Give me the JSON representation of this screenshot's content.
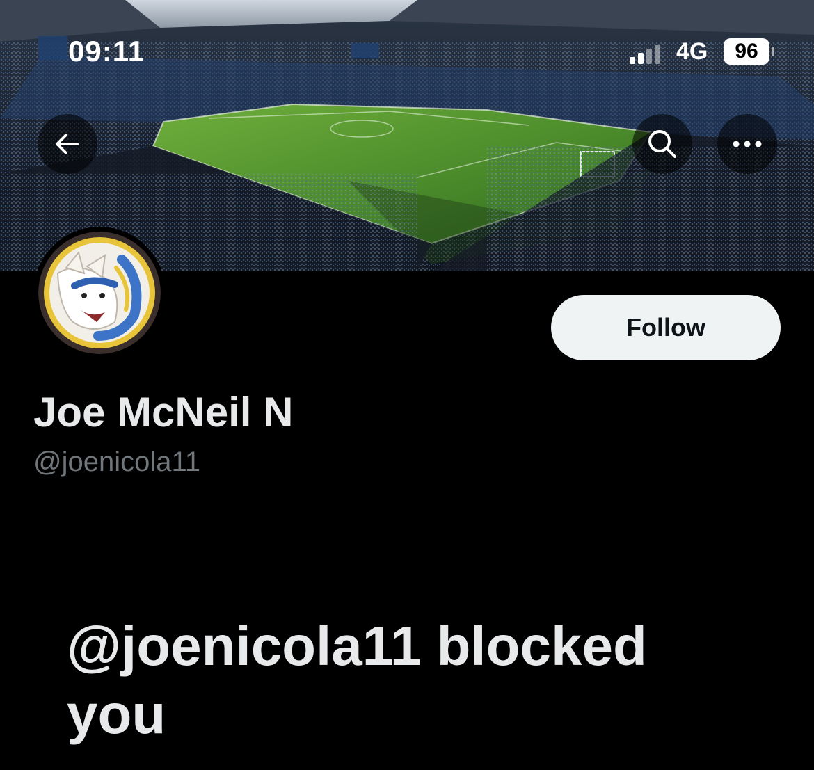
{
  "status_bar": {
    "time": "09:11",
    "network": "4G",
    "battery": "96"
  },
  "header": {
    "back_icon": "arrow-left-icon",
    "search_icon": "search-icon",
    "more_icon": "more-horizontal-icon"
  },
  "profile": {
    "display_name": "Joe McNeil N",
    "handle": "@joenicola11",
    "follow_label": "Follow"
  },
  "blocked_message": "@joenicola11 blocked you",
  "colors": {
    "background": "#000000",
    "primary_text": "#e7e9ea",
    "secondary_text": "#71767b",
    "follow_button_bg": "#eff3f4",
    "follow_button_text": "#0f1419"
  }
}
